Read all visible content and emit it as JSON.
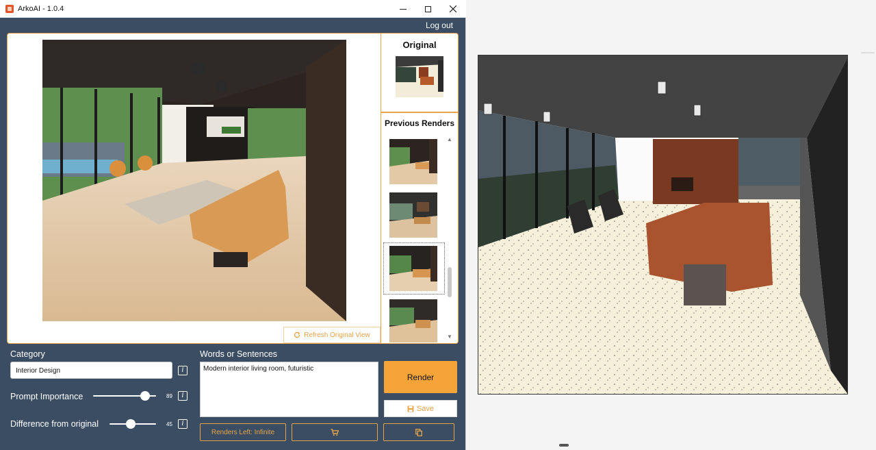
{
  "window": {
    "title": "ArkoAI - 1.0.4",
    "controls": [
      "minimize-icon",
      "maximize-icon",
      "close-icon"
    ]
  },
  "header": {
    "logout_label": "Log out"
  },
  "render_panel": {
    "refresh_label": "Refresh Original View",
    "refresh_icon": "refresh-icon"
  },
  "side": {
    "original_title": "Original",
    "previous_title": "Previous Renders",
    "thumbnails_count": 4,
    "selected_index": 2
  },
  "controls": {
    "category_label": "Category",
    "category_value": "Interior Design",
    "prompt_importance_label": "Prompt Importance",
    "prompt_importance_value": "89",
    "difference_label": "Difference from original",
    "difference_value": "45",
    "info_glyph": "i",
    "words_label": "Words or Sentences",
    "words_value": "Modern interior living room, futuristic",
    "render_label": "Render",
    "save_label": "Save",
    "renders_left_label": "Renders Left: Infinite",
    "cart_icon": "cart-icon",
    "copy_icon": "copy-icon"
  },
  "colors": {
    "accent": "#f5a43a",
    "panel_bg": "#3a4d63",
    "border_accent": "#e8a44a"
  },
  "sliders": {
    "prompt_importance_fraction": 0.89,
    "difference_fraction": 0.45
  }
}
